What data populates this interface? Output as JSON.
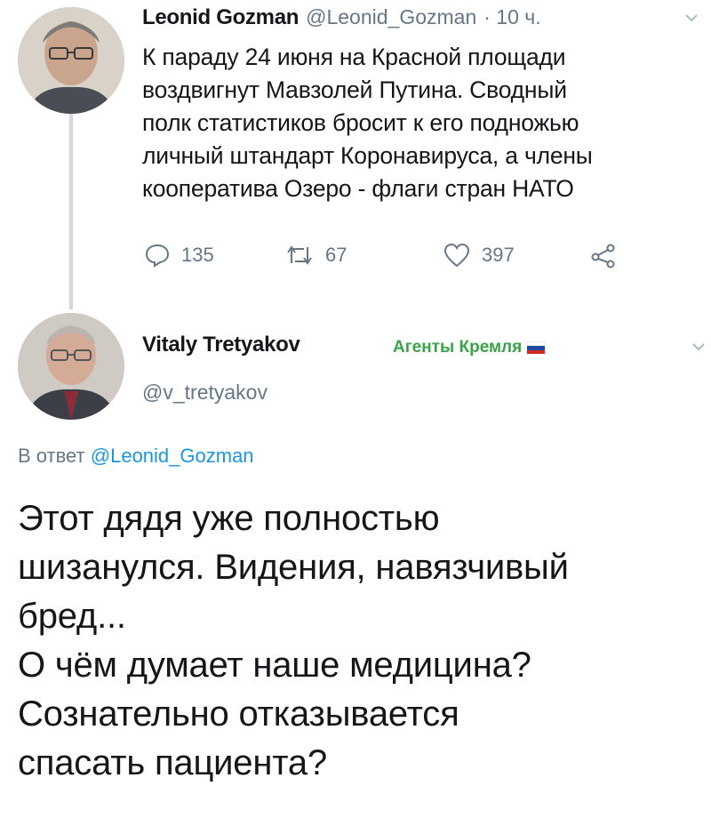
{
  "tweet1": {
    "author_name": "Leonid Gozman",
    "handle": "@Leonid_Gozman",
    "time": "· 10 ч.",
    "text_lines": [
      "К параду 24 июня на Красной площади",
      "воздвигнут Мавзолей Путина. Сводный",
      "полк статистиков бросит к его подножью",
      "личный штандарт Коронавируса, а члены",
      "кооператива Озеро - флаги стран НАТО"
    ],
    "replies": "135",
    "retweets": "67",
    "likes": "397"
  },
  "tweet2": {
    "author_name": "Vitaly Tretyakov",
    "handle": "@v_tretyakov",
    "badge_text": "Агенты Кремля",
    "reply_prefix": "В ответ",
    "reply_handle": "@Leonid_Gozman",
    "text_lines": [
      "Этот дядя уже полностью",
      "шизанулся. Видения, навязчивый",
      "бред...",
      "О чём думает наше медицина?",
      "Сознательно отказывается",
      "спасать пациента?"
    ]
  },
  "colors": {
    "text": "#14171a",
    "muted": "#657786",
    "link": "#1b95e0",
    "badge": "#3aa34a",
    "thread_line": "#cfd9de"
  },
  "icons": [
    "reply-icon",
    "retweet-icon",
    "like-icon",
    "share-icon",
    "chevron-down-icon",
    "russian-flag-icon"
  ]
}
